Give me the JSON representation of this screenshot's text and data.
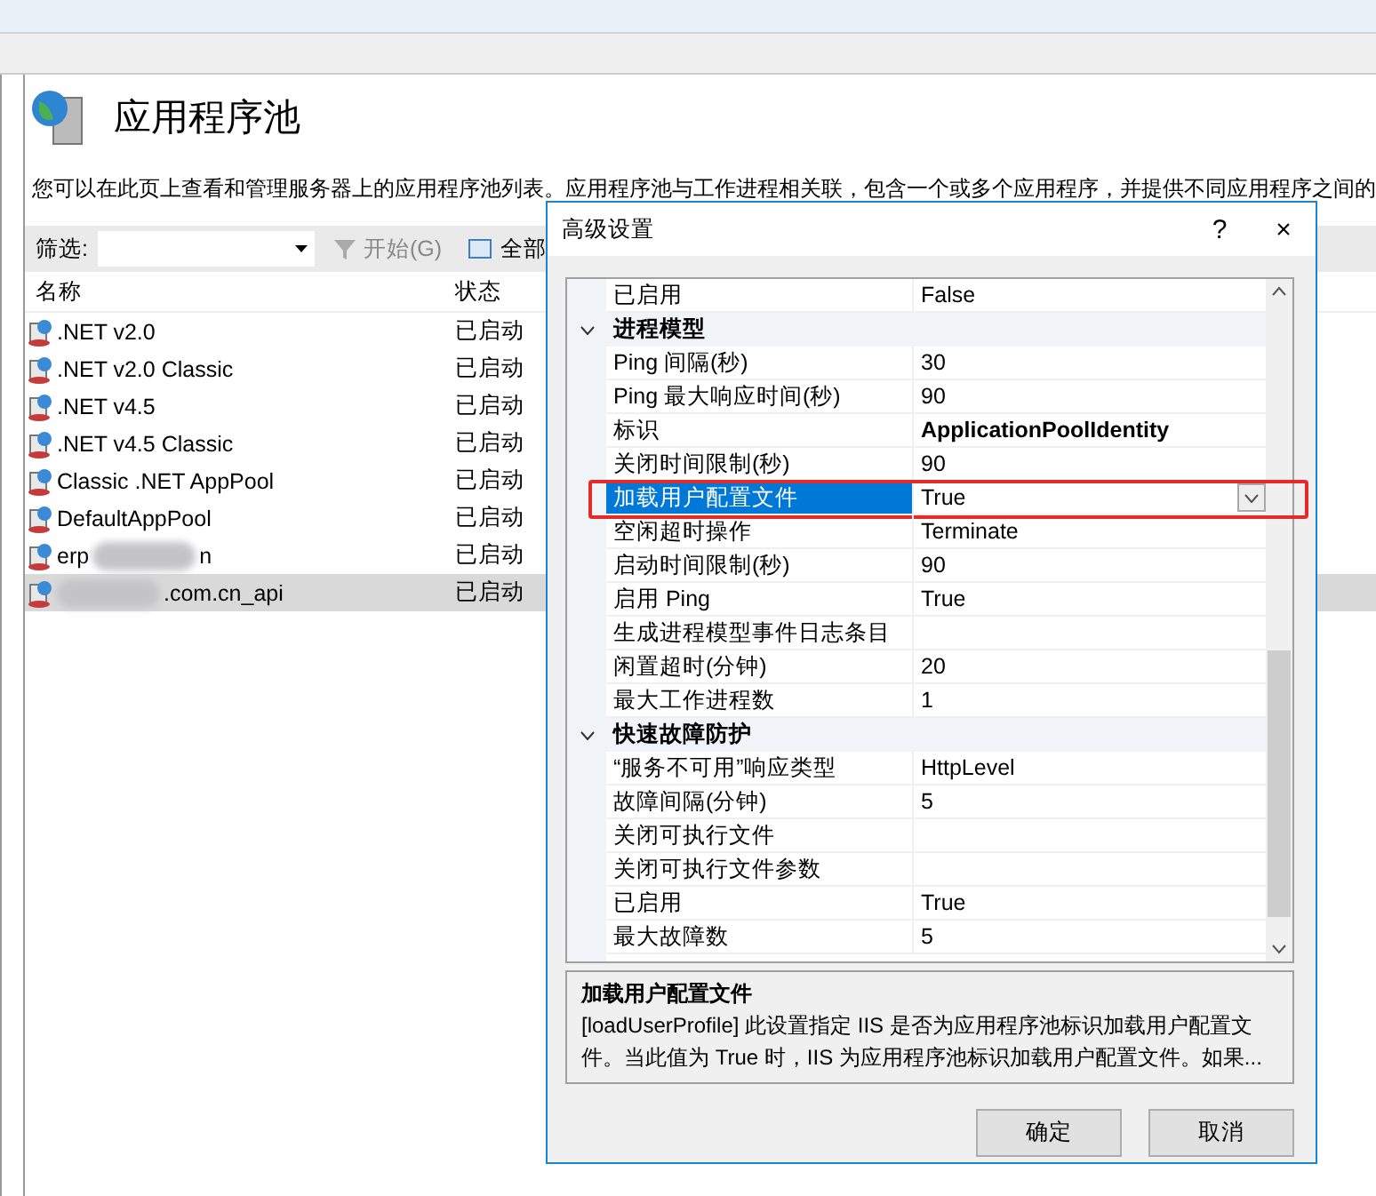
{
  "page": {
    "title": "应用程序池",
    "description": "您可以在此页上查看和管理服务器上的应用程序池列表。应用程序池与工作进程相关联，包含一个或多个应用程序，并提供不同应用程序之间的"
  },
  "toolbar": {
    "filter_label": "筛选:",
    "start_button": "开始(G)",
    "show_all_button": "全部"
  },
  "table": {
    "columns": [
      "名称",
      "状态"
    ],
    "rows": [
      {
        "name": ".NET v2.0",
        "status": "已启动",
        "selected": false
      },
      {
        "name": ".NET v2.0 Classic",
        "status": "已启动",
        "selected": false
      },
      {
        "name": ".NET v4.5",
        "status": "已启动",
        "selected": false
      },
      {
        "name": ".NET v4.5 Classic",
        "status": "已启动",
        "selected": false
      },
      {
        "name": "Classic .NET AppPool",
        "status": "已启动",
        "selected": false
      },
      {
        "name": "DefaultAppPool",
        "status": "已启动",
        "selected": false
      },
      {
        "name": "erp",
        "name_end": "n",
        "blurred": true,
        "status": "已启动",
        "selected": false
      },
      {
        "name": "",
        "name_end": ".com.cn_api",
        "blurred": true,
        "status": "已启动",
        "selected": true
      }
    ]
  },
  "dialog": {
    "title": "高级设置",
    "help": "?",
    "close": "×",
    "properties": [
      {
        "kind": "property",
        "name": "已启用",
        "value": "False",
        "selected": false
      },
      {
        "kind": "category",
        "name": "进程模型",
        "expanded": true
      },
      {
        "kind": "property",
        "name": "Ping 间隔(秒)",
        "value": "30",
        "selected": false
      },
      {
        "kind": "property",
        "name": "Ping 最大响应时间(秒)",
        "value": "90",
        "selected": false
      },
      {
        "kind": "property",
        "name": "标识",
        "value": "ApplicationPoolIdentity",
        "bold": true,
        "selected": false
      },
      {
        "kind": "property",
        "name": "关闭时间限制(秒)",
        "value": "90",
        "selected": false
      },
      {
        "kind": "property",
        "name": "加载用户配置文件",
        "value": "True",
        "selected": true,
        "highlighted": true
      },
      {
        "kind": "property",
        "name": "空闲超时操作",
        "value": "Terminate",
        "selected": false
      },
      {
        "kind": "property",
        "name": "启动时间限制(秒)",
        "value": "90",
        "selected": false
      },
      {
        "kind": "property",
        "name": "启用 Ping",
        "value": "True",
        "selected": false
      },
      {
        "kind": "property",
        "name": "生成进程模型事件日志条目",
        "selected": false
      },
      {
        "kind": "property",
        "name": "闲置超时(分钟)",
        "value": "20",
        "selected": false
      },
      {
        "kind": "property",
        "name": "最大工作进程数",
        "value": "1",
        "selected": false
      },
      {
        "kind": "category",
        "name": "快速故障防护",
        "expanded": true
      },
      {
        "kind": "property",
        "name": "“服务不可用”响应类型",
        "value": "HttpLevel",
        "selected": false
      },
      {
        "kind": "property",
        "name": "故障间隔(分钟)",
        "value": "5",
        "selected": false
      },
      {
        "kind": "property",
        "name": "关闭可执行文件",
        "selected": false
      },
      {
        "kind": "property",
        "name": "关闭可执行文件参数",
        "selected": false
      },
      {
        "kind": "property",
        "name": "已启用",
        "value": "True",
        "selected": false
      },
      {
        "kind": "property",
        "name": "最大故障数",
        "value": "5",
        "selected": false
      }
    ],
    "help_panel": {
      "title": "加载用户配置文件",
      "text": "[loadUserProfile] 此设置指定 IIS 是否为应用程序池标识加载用户配置文件。当此值为 True 时，IIS 为应用程序池标识加载用户配置文件。如果..."
    },
    "buttons": [
      "确定",
      "取消"
    ]
  }
}
